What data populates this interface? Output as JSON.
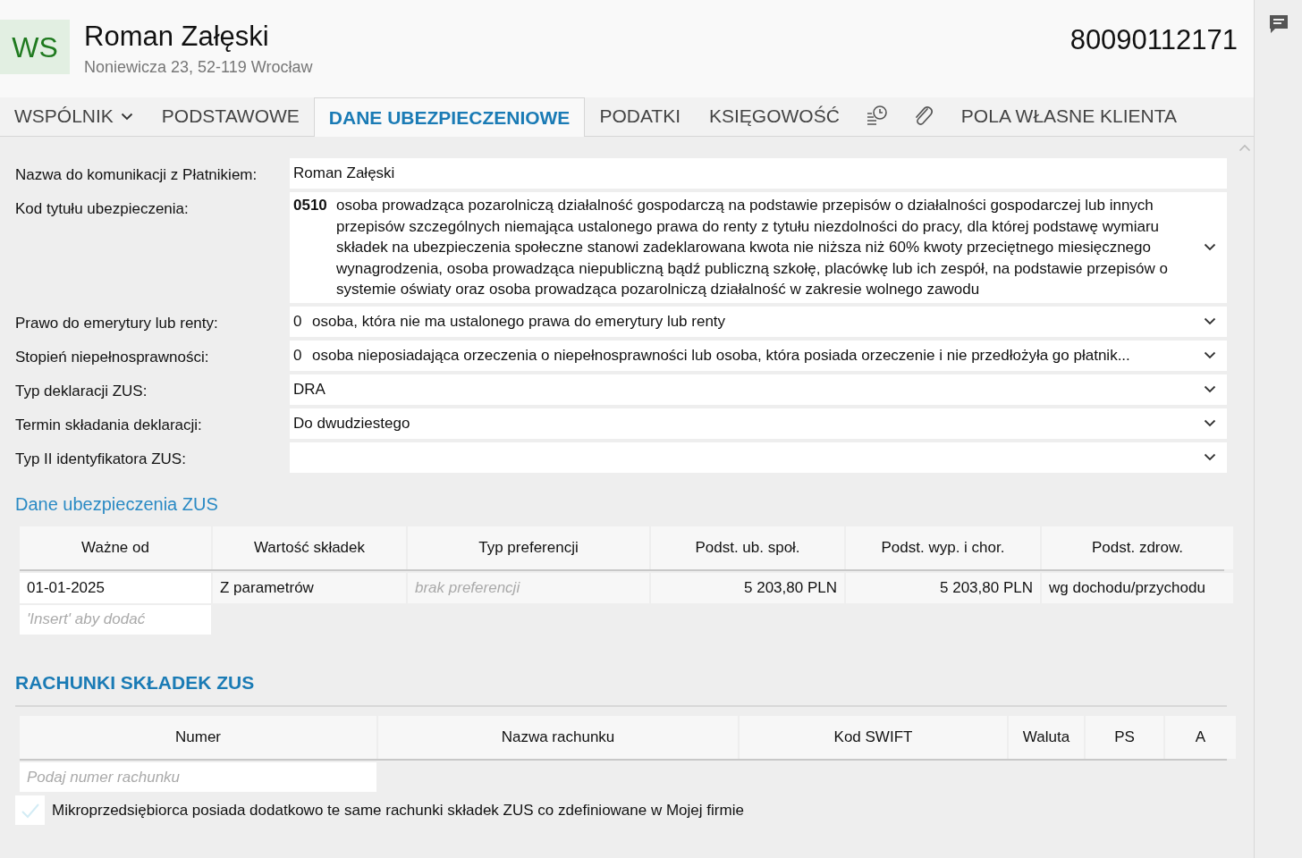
{
  "header": {
    "avatar": "WS",
    "name": "Roman Załęski",
    "address": "Noniewicza 23, 52-119 Wrocław",
    "number": "80090112171"
  },
  "tabs": [
    {
      "kind": "dropdown",
      "label": "WSPÓLNIK",
      "selected": false
    },
    {
      "kind": "text",
      "label": "PODSTAWOWE",
      "selected": false
    },
    {
      "kind": "text",
      "label": "DANE UBEZPIECZENIOWE",
      "selected": true
    },
    {
      "kind": "text",
      "label": "PODATKI",
      "selected": false
    },
    {
      "kind": "text",
      "label": "KSIĘGOWOŚĆ",
      "selected": false
    },
    {
      "kind": "history",
      "selected": false
    },
    {
      "kind": "attachment",
      "selected": false
    },
    {
      "kind": "text",
      "label": "POLA WŁASNE KLIENTA",
      "selected": false
    }
  ],
  "form": [
    {
      "kind": "text",
      "label": "Nazwa do komunikacji z Płatnikiem:",
      "value": "Roman Załęski"
    },
    {
      "kind": "select",
      "label": "Kod tytułu ubezpieczenia:",
      "code": "0510",
      "value": "osoba prowadząca pozarolniczą działalność gospodarczą na podstawie przepisów o działalności gospodarczej lub innych przepisów szczególnych niemająca ustalonego prawa do renty z tytułu niezdolności do pracy, dla której podstawę wymiaru składek na ubezpieczenia społeczne stanowi zadeklarowana kwota nie niższa niż 60% kwoty przeciętnego miesięcznego wynagrodzenia, osoba prowadząca niepubliczną bądź publiczną szkołę, placówkę lub ich zespół, na podstawie przepisów o systemie oświaty oraz osoba prowadząca pozarolniczą działalność w zakresie wolnego zawodu"
    },
    {
      "kind": "select",
      "label": "Prawo do emerytury lub renty:",
      "code": "0",
      "value": "osoba, która nie ma ustalonego prawa do emerytury lub renty"
    },
    {
      "kind": "select",
      "label": "Stopień niepełnosprawności:",
      "code": "0",
      "value": "osoba nieposiadająca orzeczenia o niepełnosprawności lub osoba, która posiada orzeczenie i nie przedłożyła go płatnik..."
    },
    {
      "kind": "select",
      "label": "Typ deklaracji ZUS:",
      "value": "DRA"
    },
    {
      "kind": "select",
      "label": "Termin składania deklaracji:",
      "value": "Do dwudziestego"
    },
    {
      "kind": "select",
      "label": "Typ II identyfikatora ZUS:"
    }
  ],
  "insurance": {
    "title": "Dane ubezpieczenia ZUS",
    "columns": [
      "Ważne od",
      "Wartość składek",
      "Typ preferencji",
      "Podst. ub. społ.",
      "Podst. wyp. i chor.",
      "Podst. zdrow."
    ],
    "rows": [
      [
        {
          "kind": "date",
          "text": "01-01-2025"
        },
        {
          "kind": "text",
          "text": "Z parametrów"
        },
        {
          "kind": "hint",
          "text": "brak preferencji"
        },
        {
          "kind": "amount",
          "text": "5 203,80 PLN"
        },
        {
          "kind": "amount",
          "text": "5 203,80 PLN"
        },
        {
          "kind": "text",
          "text": "wg dochodu/przychodu"
        }
      ]
    ],
    "add_placeholder": "'Insert' aby dodać"
  },
  "accounts": {
    "title": "RACHUNKI SKŁADEK ZUS",
    "columns": [
      "Numer",
      "Nazwa rachunku",
      "Kod SWIFT",
      "Waluta",
      "PS",
      "A"
    ],
    "placeholder": "Podaj numer rachunku",
    "checkbox": {
      "label": "Mikroprzedsiębiorca posiada dodatkowo te same rachunki składek ZUS co zdefiniowane w Mojej firmie",
      "checked": false
    }
  }
}
